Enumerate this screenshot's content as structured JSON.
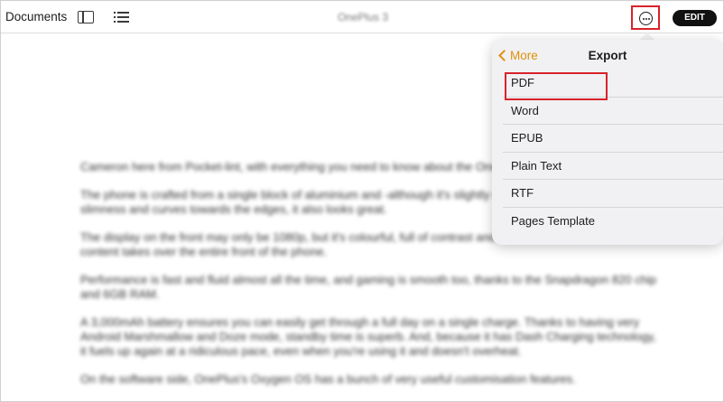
{
  "toolbar": {
    "documents_label": "Documents",
    "document_title": "OnePlus 3",
    "edit_label": "EDIT"
  },
  "popover": {
    "back_label": "More",
    "title": "Export",
    "items": [
      {
        "label": "PDF",
        "highlighted": true
      },
      {
        "label": "Word"
      },
      {
        "label": "EPUB"
      },
      {
        "label": "Plain Text"
      },
      {
        "label": "RTF"
      },
      {
        "label": "Pages Template"
      }
    ]
  },
  "document": {
    "paragraphs": [
      "Cameron here from Pocket-lint, with everything you need to know about the OnePlus 3.",
      "The phone is crafted from a single block of aluminium and -although it's slightly on the big side- thanks to the slimness and curves towards the edges, it also looks great.",
      "The display on the front may only be 1080p, but it's colourful, full of contrast and has been slim bezels, that content takes over the entire front of the phone.",
      "Performance is fast and fluid almost all the time, and gaming is smooth too, thanks to the Snapdragon 820 chip and 6GB RAM.",
      "A 3,000mAh battery ensures you can easily get through a full day on a single charge. Thanks to having very Android Marshmallow and Doze mode, standby time is superb. And, because it has Dash Charging technology, it fuels up again at a ridiculous pace, even when you're using it and doesn't overheat.",
      "On the software side, OnePlus's Oxygen OS has a bunch of very useful customisation features."
    ]
  },
  "colors": {
    "accent": "#e0900b",
    "highlight_outline": "#d8232a",
    "edit_button_bg": "#111111"
  },
  "icons": [
    "sidebar-toggle-icon",
    "list-icon",
    "more-options-icon",
    "chevron-left-icon"
  ]
}
